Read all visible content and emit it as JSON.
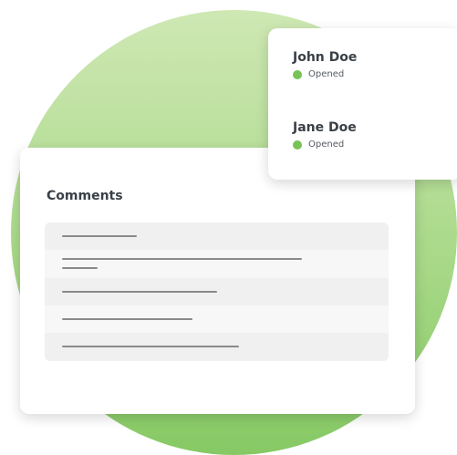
{
  "comments_card": {
    "title": "Comments",
    "rows": 5
  },
  "recipients": [
    {
      "name": "John Doe",
      "status": "Opened",
      "status_color": "#78c256"
    },
    {
      "name": "Jane Doe",
      "status": "Opened",
      "status_color": "#78c256"
    }
  ],
  "colors": {
    "accent_green": "#78c256",
    "text_dark": "#3a4048",
    "placeholder_line": "#8a8a8a"
  }
}
